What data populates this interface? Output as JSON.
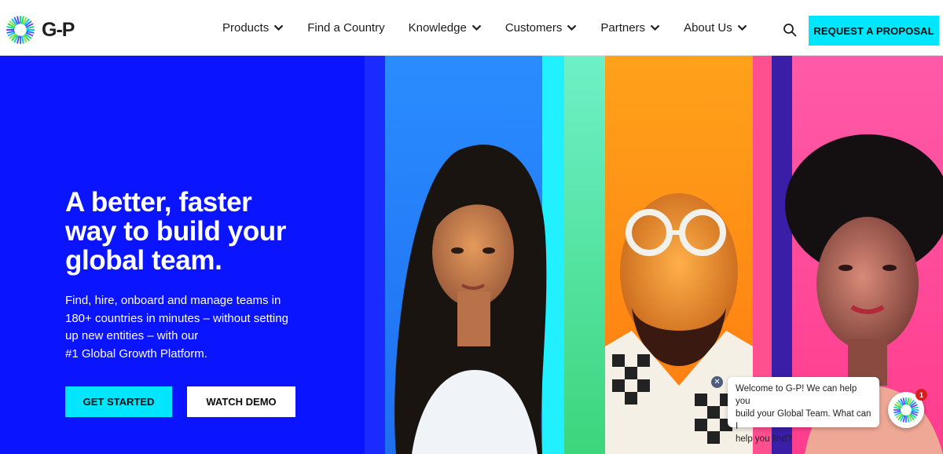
{
  "brand": {
    "logo_text": "G-P",
    "accent": "#00e6ff",
    "hero_blue": "#0a14ff"
  },
  "nav": {
    "items": [
      {
        "label": "Products",
        "has_dropdown": true
      },
      {
        "label": "Find a Country",
        "has_dropdown": false
      },
      {
        "label": "Knowledge",
        "has_dropdown": true
      },
      {
        "label": "Customers",
        "has_dropdown": true
      },
      {
        "label": "Partners",
        "has_dropdown": true
      },
      {
        "label": "About Us",
        "has_dropdown": true
      }
    ],
    "search_icon": "search-icon",
    "cta_label": "REQUEST A PROPOSAL"
  },
  "hero": {
    "headline_lines": [
      "A better, faster",
      "way to build your",
      "global team."
    ],
    "subcopy_lines": [
      "Find, hire, onboard and manage teams in",
      "180+ countries in minutes – without setting",
      "up new entities – with our",
      "#1 Global Growth Platform."
    ],
    "primary_button": "GET STARTED",
    "secondary_button": "WATCH DEMO"
  },
  "chat": {
    "message_lines": [
      "Welcome to G-P! We can help you",
      "build your Global Team. What can I",
      "help you find?"
    ],
    "close_icon": "close-icon",
    "badge_count": "1"
  }
}
